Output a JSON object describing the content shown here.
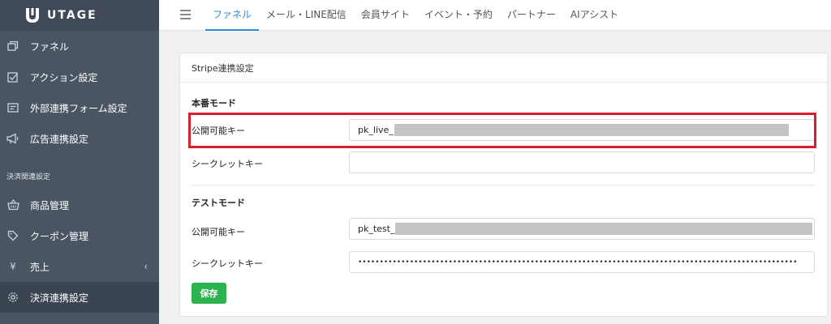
{
  "app": {
    "name": "UTAGE"
  },
  "sidebar": {
    "items": [
      {
        "label": "ファネル",
        "icon": "funnel-icon"
      },
      {
        "label": "アクション設定",
        "icon": "checkbox-icon"
      },
      {
        "label": "外部連携フォーム設定",
        "icon": "form-icon"
      },
      {
        "label": "広告連携設定",
        "icon": "megaphone-icon"
      }
    ],
    "section_label": "決済関連設定",
    "payment_items": [
      {
        "label": "商品管理",
        "icon": "basket-icon"
      },
      {
        "label": "クーポン管理",
        "icon": "tag-icon"
      },
      {
        "label": "売上",
        "icon": "yen-icon",
        "chevron": "‹"
      },
      {
        "label": "決済連携設定",
        "icon": "gear-icon",
        "active": true
      }
    ]
  },
  "topnav": {
    "tabs": [
      {
        "label": "ファネル",
        "active": true
      },
      {
        "label": "メール・LINE配信"
      },
      {
        "label": "会員サイト"
      },
      {
        "label": "イベント・予約"
      },
      {
        "label": "パートナー"
      },
      {
        "label": "AIアシスト"
      }
    ]
  },
  "card": {
    "title": "Stripe連携設定",
    "live": {
      "heading": "本番モード",
      "public_key_label": "公開可能キー",
      "public_key_value": "pk_live_",
      "secret_key_label": "シークレットキー",
      "secret_key_value": ""
    },
    "test": {
      "heading": "テストモード",
      "public_key_label": "公開可能キー",
      "public_key_value": "pk_test_",
      "secret_key_label": "シークレットキー",
      "secret_key_value": "••••••••••••••••••••••••••••••••••••••••••••••••••••••••••••••••••••••••••••••••••••••••••••••••••••••"
    },
    "save_label": "保存"
  },
  "colors": {
    "sidebar_bg": "#4a5563",
    "accent_blue": "#2d8fd6",
    "save_green": "#2bb34f",
    "highlight_red": "#d8202a"
  }
}
